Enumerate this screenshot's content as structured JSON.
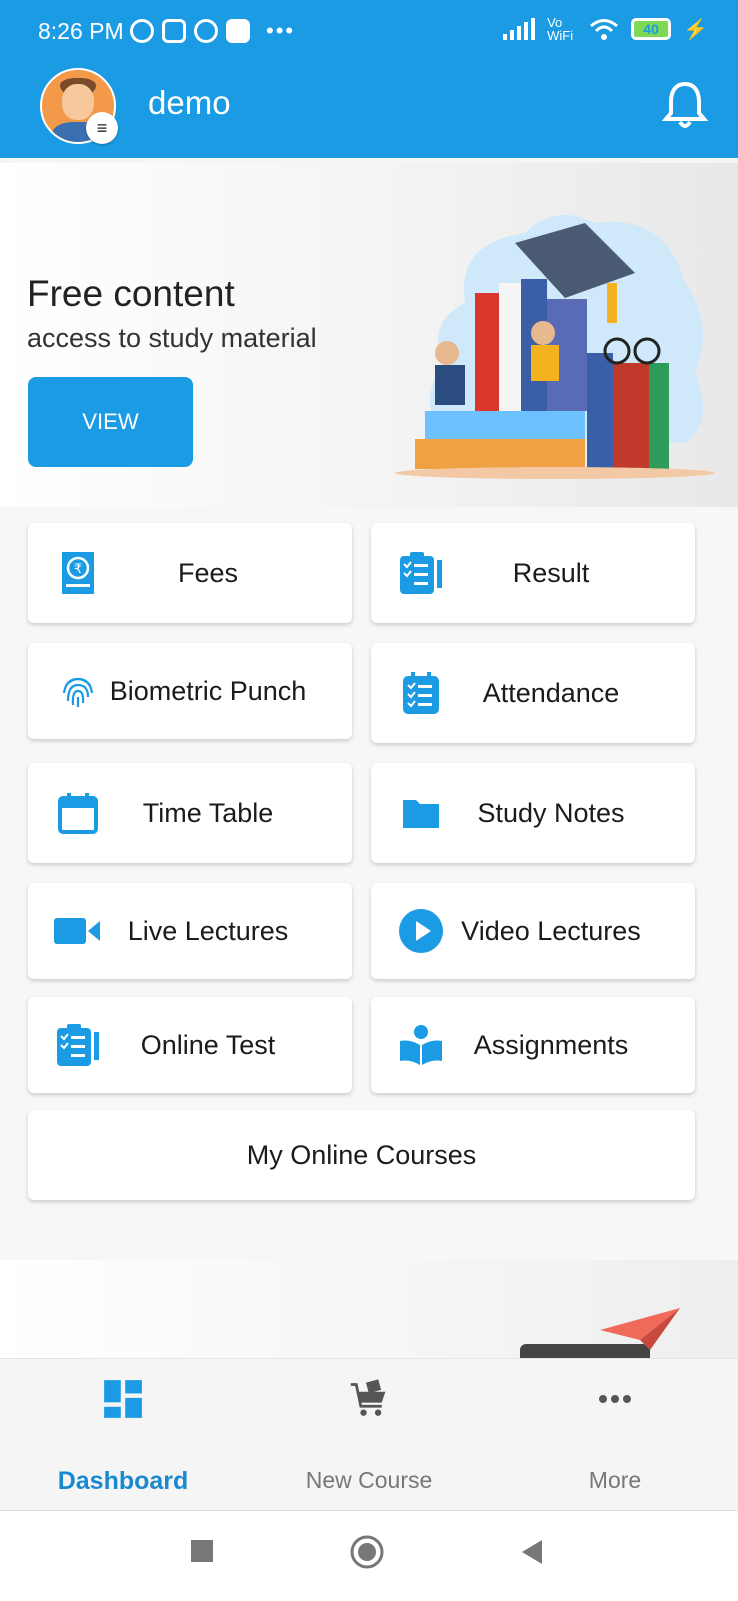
{
  "status_bar": {
    "time": "8:26 PM",
    "battery": "40",
    "network": "Vo WiFi"
  },
  "header": {
    "username": "demo"
  },
  "banner": {
    "title": "Free content",
    "subtitle": "access to study material",
    "button": "VIEW"
  },
  "menu": {
    "fees": "Fees",
    "result": "Result",
    "biometric": "Biometric Punch",
    "attendance": "Attendance",
    "timetable": "Time Table",
    "studynotes": "Study Notes",
    "live": "Live Lectures",
    "video": "Video Lectures",
    "onlinetest": "Online Test",
    "assignments": "Assignments",
    "courses": "My Online Courses"
  },
  "bottom_nav": {
    "dashboard": "Dashboard",
    "newcourse": "New Course",
    "more": "More"
  },
  "colors": {
    "primary": "#1a9be3",
    "active_tab": "#1a8ad0"
  }
}
